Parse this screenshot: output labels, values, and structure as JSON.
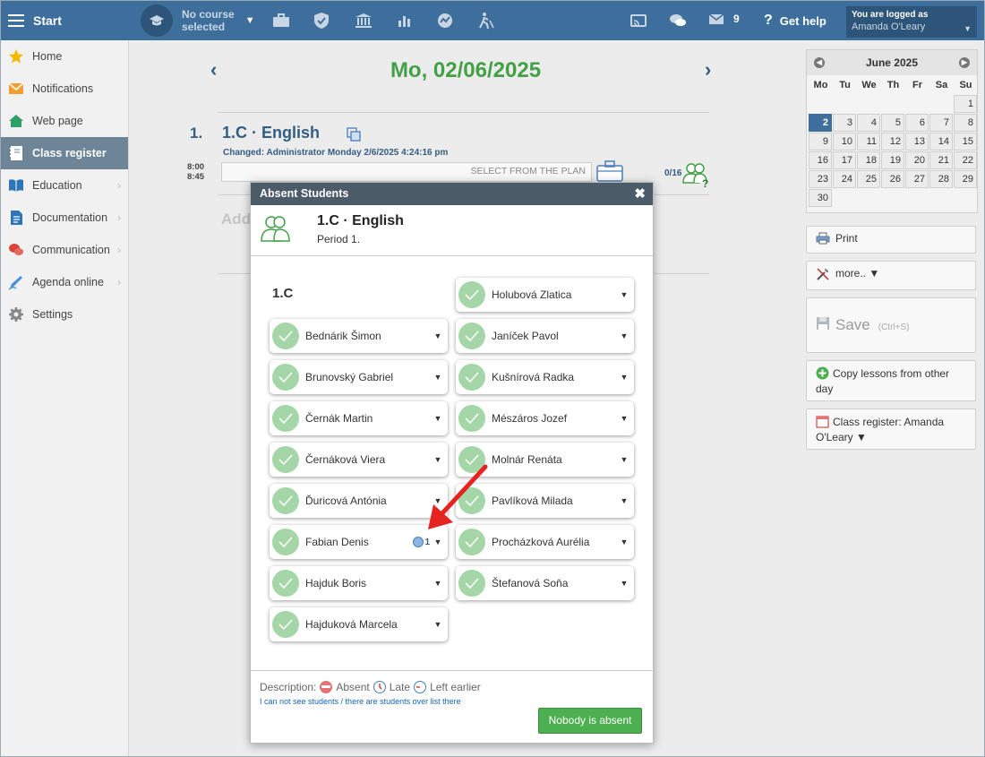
{
  "topbar": {
    "start_label": "Start",
    "course_line1": "No course",
    "course_line2": "selected",
    "message_count": "9",
    "help_label": "Get help",
    "logged_as_label": "You are logged as",
    "user_name": "Amanda O'Leary"
  },
  "sidebar": {
    "items": [
      {
        "label": "Home",
        "icon": "star-icon"
      },
      {
        "label": "Notifications",
        "icon": "envelope-icon"
      },
      {
        "label": "Web page",
        "icon": "house-icon"
      },
      {
        "label": "Class register",
        "icon": "notebook-icon"
      },
      {
        "label": "Education",
        "icon": "book-icon"
      },
      {
        "label": "Documentation",
        "icon": "document-icon"
      },
      {
        "label": "Communication",
        "icon": "chat-icon"
      },
      {
        "label": "Agenda online",
        "icon": "pen-icon"
      },
      {
        "label": "Settings",
        "icon": "gear-icon"
      }
    ]
  },
  "main": {
    "date": "Mo, 02/06/2025",
    "lesson_number": "1.",
    "lesson_title": "1.C · English",
    "changed": "Changed: Administrator Monday 2/6/2025 4:24:16 pm",
    "time_start": "8:00",
    "time_end": "8:45",
    "plan_placeholder": "SELECT FROM THE PLAN",
    "student_count": "0/16",
    "add_text": "Add"
  },
  "calendar": {
    "month": "June 2025",
    "weekdays": [
      "Mo",
      "Tu",
      "We",
      "Th",
      "Fr",
      "Sa",
      "Su"
    ],
    "selected_day": "2"
  },
  "right_buttons": {
    "print": "Print",
    "more": "more.. ▼",
    "save": "Save",
    "save_shortcut": "(Ctrl+S)",
    "copy": "Copy lessons from other day",
    "register": "Class register: Amanda O'Leary ▼"
  },
  "modal": {
    "title": "Absent Students",
    "class_title": "1.C · English",
    "period": "Period 1.",
    "group_label": "1.C",
    "students_left": [
      "Bednárik Šimon",
      "Brunovský Gabriel",
      "Černák Martin",
      "Černáková Viera",
      "Ďuricová Antónia",
      "Fabian Denis",
      "Hajduk Boris",
      "Hajduková Marcela"
    ],
    "students_right": [
      "Holubová Zlatica",
      "Janíček Pavol",
      "Kušnírová Radka",
      "Mészáros Jozef",
      "Molnár Renáta",
      "Pavlíková Milada",
      "Procházková Aurélia",
      "Štefanová Soňa"
    ],
    "info_count": "1",
    "description_label": "Description:",
    "absent_label": "Absent",
    "late_label": "Late",
    "left_earlier_label": "Left earlier",
    "cant_see": "I can not see students / there are students over list there",
    "nobody_button": "Nobody is absent"
  },
  "colors": {
    "topbar": "#3e6f9c",
    "date_green": "#43a047",
    "accent_blue": "#345d84",
    "check_green": "#a5d6a7",
    "arrow_red": "#e52421"
  }
}
